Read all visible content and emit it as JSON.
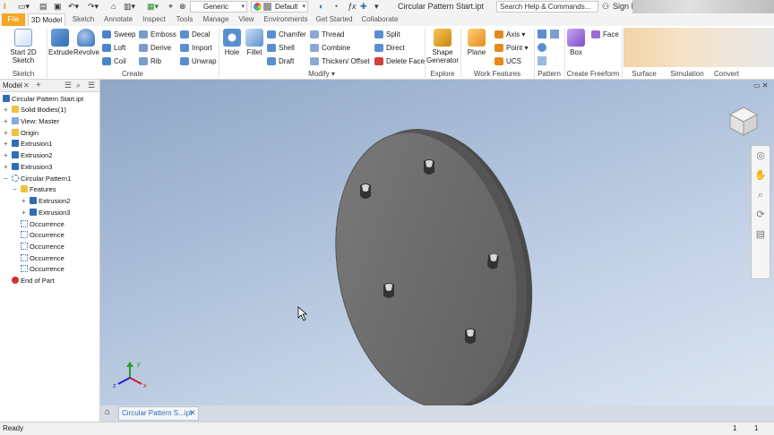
{
  "app": {
    "window_title": "Circular Pattern Start.ipt",
    "sign_in": "Sign In"
  },
  "qat": {
    "material": "Generic",
    "appearance": "Default",
    "search_placeholder": "Search Help & Commands..."
  },
  "tabs": [
    "File",
    "3D Model",
    "Sketch",
    "Annotate",
    "Inspect",
    "Tools",
    "Manage",
    "View",
    "Environments",
    "Get Started",
    "Collaborate"
  ],
  "ribbon": {
    "sketch": {
      "start_2d": "Start 2D Sketch",
      "panel": "Sketch"
    },
    "create": {
      "extrude": "Extrude",
      "revolve": "Revolve",
      "sweep": "Sweep",
      "loft": "Loft",
      "coil": "Coil",
      "emboss": "Emboss",
      "derive": "Derive",
      "rib": "Rib",
      "decal": "Decal",
      "import": "Import",
      "unwrap": "Unwrap",
      "panel": "Create"
    },
    "modify": {
      "hole": "Hole",
      "fillet": "Fillet",
      "chamfer": "Chamfer",
      "shell": "Shell",
      "draft": "Draft",
      "thread": "Thread",
      "combine": "Combine",
      "thicken": "Thicken/ Offset",
      "split": "Split",
      "direct": "Direct",
      "delete_face": "Delete Face",
      "panel": "Modify ▾"
    },
    "explore": {
      "shape_generator": "Shape Generator",
      "panel": "Explore"
    },
    "work": {
      "plane": "Plane",
      "axis": "Axis",
      "point": "Point",
      "ucs": "UCS",
      "panel": "Work Features"
    },
    "pattern": {
      "panel": "Pattern"
    },
    "freeform": {
      "box": "Box",
      "face": "Face",
      "panel": "Create Freeform"
    },
    "surface": {
      "panel": "Surface"
    },
    "simulation": {
      "panel": "Simulation"
    },
    "convert": {
      "panel": "Convert"
    }
  },
  "browser": {
    "header": "Model",
    "items": [
      {
        "label": "Circular Pattern Start.ipt"
      },
      {
        "label": "Solid Bodies(1)"
      },
      {
        "label": "View: Master"
      },
      {
        "label": "Origin"
      },
      {
        "label": "Extrusion1"
      },
      {
        "label": "Extrusion2"
      },
      {
        "label": "Extrusion3"
      },
      {
        "label": "Circular Pattern1"
      },
      {
        "label": "Features"
      },
      {
        "label": "Extrusion2"
      },
      {
        "label": "Extrusion3"
      },
      {
        "label": "Occurrence"
      },
      {
        "label": "Occurrence"
      },
      {
        "label": "Occurrence"
      },
      {
        "label": "Occurrence"
      },
      {
        "label": "Occurrence"
      },
      {
        "label": "End of Part"
      }
    ]
  },
  "doc_tab": {
    "label": "Circular Pattern S...ipt"
  },
  "status": {
    "text": "Ready",
    "count1": "1",
    "count2": "1"
  },
  "colors": {
    "file_tab": "#f5a623",
    "accent_blue": "#2f6db5",
    "part_gray": "#6f6f6f"
  }
}
